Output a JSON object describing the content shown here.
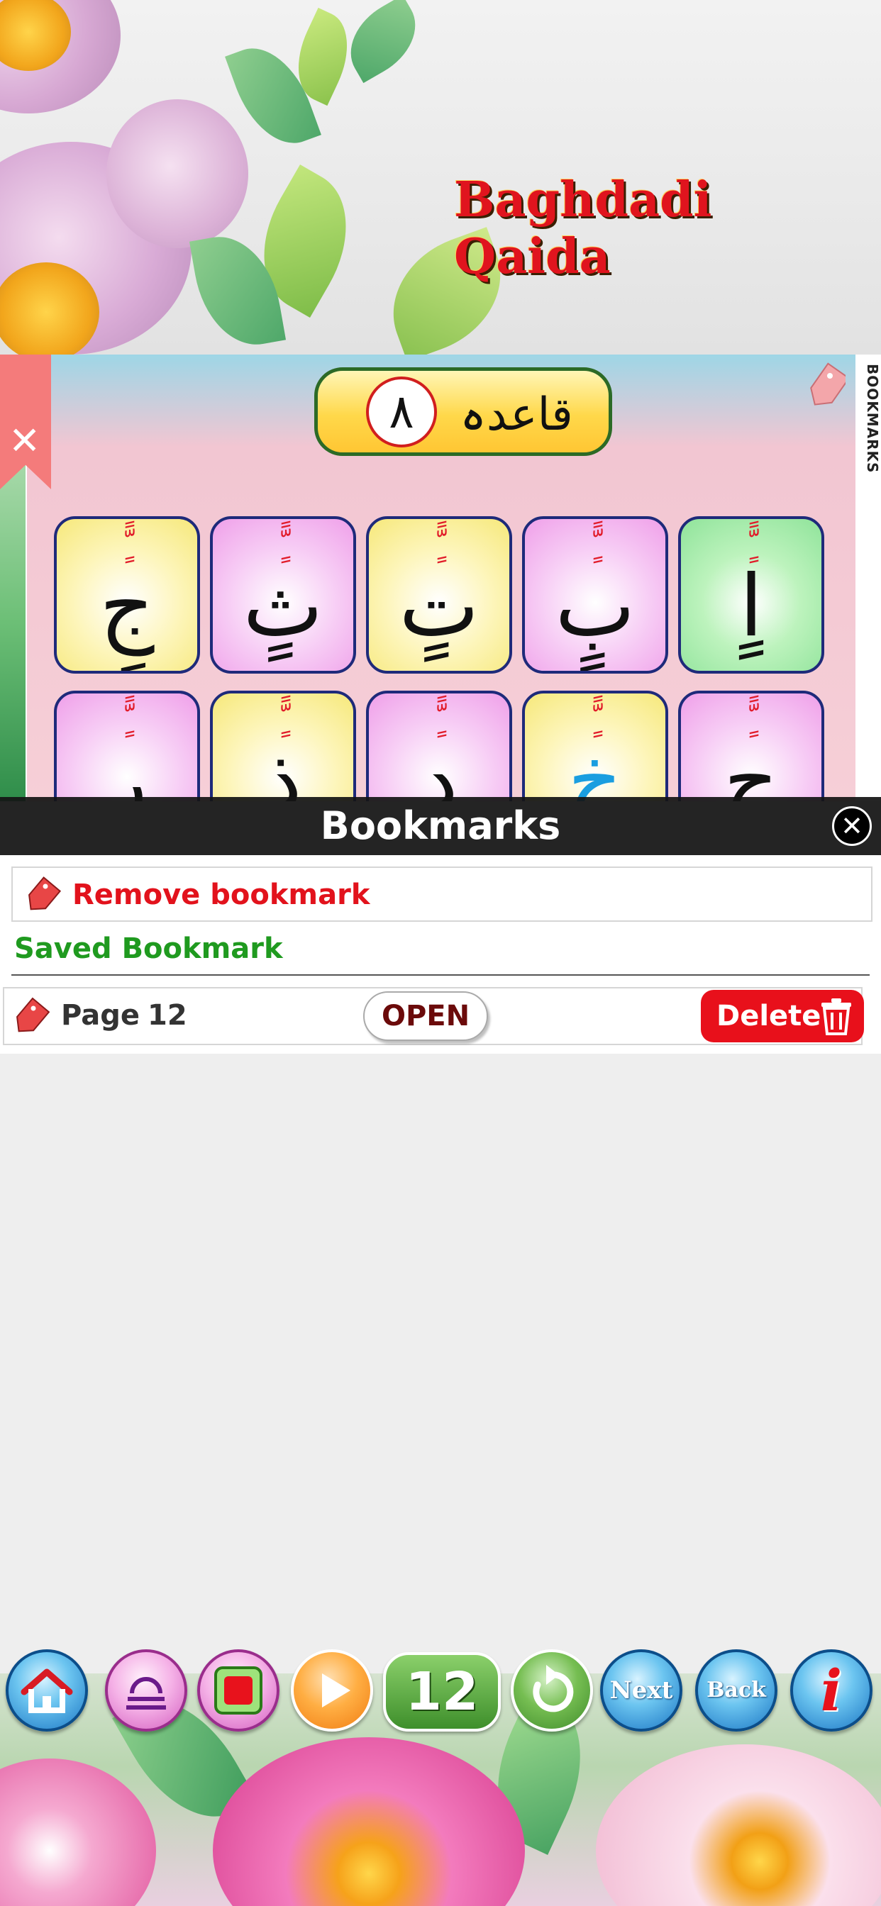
{
  "header": {
    "app_title": "Baghdadi Qaida"
  },
  "lesson": {
    "number": "٨",
    "name": "قاعدہ",
    "side_tab": "BOOKMARKS"
  },
  "tiles": {
    "row1": [
      {
        "diacritics": "ٍّ  ً",
        "letter": "جٍ",
        "color": "yellow"
      },
      {
        "diacritics": "ٍّ  ً",
        "letter": "ثٍ",
        "color": "pink"
      },
      {
        "diacritics": "ٍّ  ً",
        "letter": "تٍ",
        "color": "yellow"
      },
      {
        "diacritics": "ٍّ  ً",
        "letter": "بٍ",
        "color": "pink"
      },
      {
        "diacritics": "ٍّ  ً",
        "letter": "اٍ",
        "color": "green"
      }
    ],
    "row2": [
      {
        "diacritics": "ٍّ  ً",
        "letter": "رٍ",
        "color": "pink"
      },
      {
        "diacritics": "ٍّ  ً",
        "letter": "ذٍ",
        "color": "yellow"
      },
      {
        "diacritics": "ٍّ  ً",
        "letter": "دٍ",
        "color": "pink"
      },
      {
        "diacritics": "ٍّ  ً",
        "letter": "خٍ",
        "color": "yellow"
      },
      {
        "diacritics": "ٍّ  ً",
        "letter": "حٍ",
        "color": "pink"
      }
    ]
  },
  "bookmarks_bar": {
    "title": "Bookmarks",
    "close_symbol": "✕"
  },
  "panel": {
    "remove_label": "Remove bookmark",
    "saved_title": "Saved Bookmark",
    "items": [
      {
        "page_label": "Page",
        "page_value": "12",
        "open_label": "OPEN",
        "delete_label": "Delete"
      }
    ]
  },
  "toolbar": {
    "page_number": "12",
    "next_label": "Next",
    "back_label": "Back",
    "info_label": "i",
    "icons": [
      "home-icon",
      "scale-icon",
      "stop-icon",
      "play-icon",
      "refresh-icon",
      "info-icon"
    ]
  },
  "colors": {
    "title_red": "#e0141e",
    "remove_red": "#e2121c",
    "saved_green": "#1f9a1f",
    "delete_red": "#e8101b",
    "open_text": "#6b0a0a"
  }
}
